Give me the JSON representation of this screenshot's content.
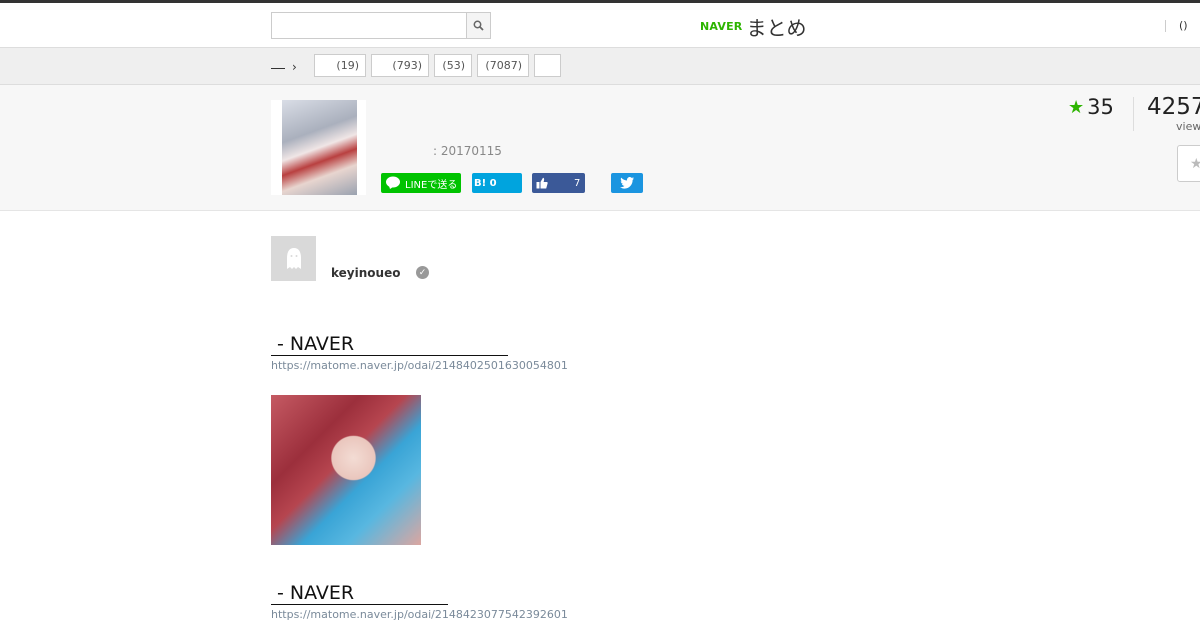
{
  "header": {
    "search": {
      "placeholder": "",
      "value": ""
    },
    "logo": {
      "brand": "NAVER",
      "service": "まとめ"
    },
    "right_link": "()"
  },
  "categories": {
    "crumb_label": "",
    "tags": [
      {
        "label": "(19)"
      },
      {
        "label": "(793)"
      },
      {
        "label": "(53)"
      },
      {
        "label": "(7087)"
      },
      {
        "label": ""
      }
    ]
  },
  "summary": {
    "date": ": 20170115",
    "share": {
      "line": "LINEで送る",
      "hatena": "B! 0",
      "facebook_count": "7"
    },
    "favorites": "35",
    "views": "4257",
    "views_label": "view"
  },
  "author": {
    "name": "keyinoueo"
  },
  "links": [
    {
      "title": " - NAVER",
      "url": "https://matome.naver.jp/odai/2148402501630054801"
    },
    {
      "title": " - NAVER",
      "url": "https://matome.naver.jp/odai/2148423077542392601"
    }
  ],
  "colors": {
    "accent": "#2db400",
    "line": "#00c300",
    "hatena": "#00a4de",
    "facebook": "#3b5998",
    "twitter": "#1b95e0"
  },
  "icons": [
    "search-icon",
    "line-icon",
    "thumbs-up-icon",
    "twitter-icon",
    "star-icon",
    "verified-icon",
    "default-avatar-icon"
  ]
}
